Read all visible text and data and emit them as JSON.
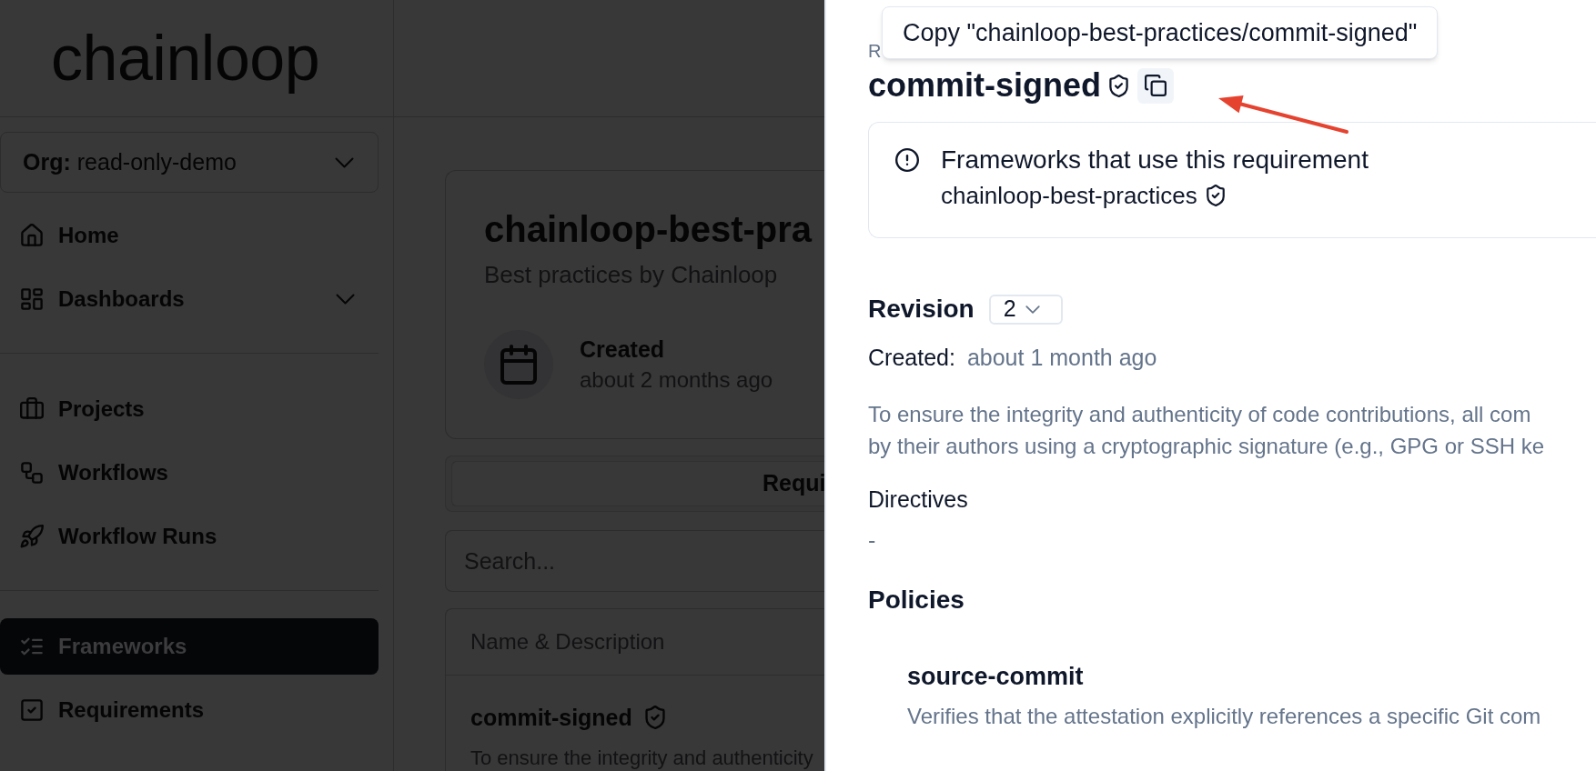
{
  "sidebar": {
    "logo": "chainloop",
    "org": {
      "label": "Org:",
      "value": "read-only-demo"
    },
    "groups": [
      {
        "items": [
          {
            "label": "Home",
            "selected": false,
            "has_submenu": false
          },
          {
            "label": "Dashboards",
            "selected": false,
            "has_submenu": true
          }
        ]
      },
      {
        "items": [
          {
            "label": "Projects",
            "selected": false,
            "has_submenu": false
          },
          {
            "label": "Workflows",
            "selected": false,
            "has_submenu": false
          },
          {
            "label": "Workflow Runs",
            "selected": false,
            "has_submenu": false
          }
        ]
      },
      {
        "items": [
          {
            "label": "Frameworks",
            "selected": true,
            "has_submenu": false
          },
          {
            "label": "Requirements",
            "selected": false,
            "has_submenu": false
          }
        ]
      }
    ]
  },
  "framework": {
    "title": "chainloop-best-pra",
    "subtitle": "Best practices by Chainloop",
    "created": {
      "label": "Created",
      "value": "about 2 months ago"
    }
  },
  "tabs": [
    {
      "label": "Requi"
    }
  ],
  "search": {
    "placeholder": "Search..."
  },
  "table": {
    "columns": [
      "Name & Description"
    ],
    "rows": [
      {
        "name": "commit-signed",
        "description": "To ensure the integrity and authenticity"
      }
    ]
  },
  "requirement": {
    "label": "R",
    "title": "commit-signed",
    "copy_tooltip": "Copy \"chainloop-best-practices/commit-signed\"",
    "frameworks_notice": {
      "title": "Frameworks that use this requirement",
      "frameworks": [
        "chainloop-best-practices"
      ]
    },
    "revision": {
      "label": "Revision",
      "value": "2"
    },
    "created": {
      "label": "Created:",
      "value": "about 1 month ago"
    },
    "description_lines": [
      "To ensure the integrity and authenticity of code contributions, all com",
      "by their authors using a cryptographic signature (e.g., GPG or SSH ke"
    ],
    "directives": {
      "label": "Directives",
      "value": "-"
    },
    "policies": {
      "title": "Policies",
      "items": [
        {
          "name": "source-commit",
          "description": "Verifies that the attestation explicitly references a specific Git com"
        }
      ]
    }
  }
}
